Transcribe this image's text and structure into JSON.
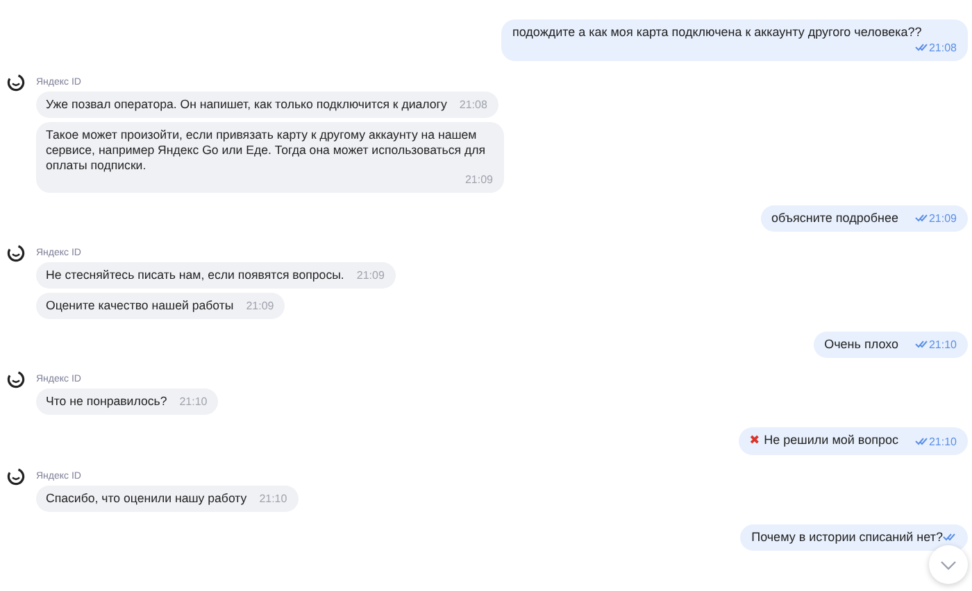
{
  "messages": [
    {
      "kind": "outgoing",
      "text": "подождите а как моя карта подключена к аккаунту другого человека??",
      "time": "21:08",
      "read": true
    },
    {
      "kind": "bot",
      "sender": "Яндекс ID",
      "bubbles": [
        {
          "text": "Уже позвал оператора. Он напишет, как только подключится к диалогу",
          "time": "21:08"
        },
        {
          "text": "Такое может произойти, если привязать карту к другому аккаунту на нашем сервисе, например Яндекс Go или Еде. Тогда она может использоваться для оплаты подписки.",
          "time": "21:09"
        }
      ]
    },
    {
      "kind": "outgoing",
      "text": "объясните подробнее",
      "time": "21:09",
      "read": true
    },
    {
      "kind": "bot",
      "sender": "Яндекс ID",
      "bubbles": [
        {
          "text": "Не стесняйтесь писать нам, если появятся вопросы.",
          "time": "21:09"
        },
        {
          "text": "Оцените качество нашей работы",
          "time": "21:09"
        }
      ]
    },
    {
      "kind": "outgoing",
      "text": "Очень плохо",
      "time": "21:10",
      "read": true
    },
    {
      "kind": "bot",
      "sender": "Яндекс ID",
      "bubbles": [
        {
          "text": "Что не понравилось?",
          "time": "21:10"
        }
      ]
    },
    {
      "kind": "outgoing",
      "emoji": "✖",
      "text": "Не решили мой вопрос",
      "time": "21:10",
      "read": true
    },
    {
      "kind": "bot",
      "sender": "Яндекс ID",
      "bubbles": [
        {
          "text": "Спасибо, что оценили нашу работу",
          "time": "21:10"
        }
      ]
    },
    {
      "kind": "outgoing",
      "text": "Почему в истории списаний нет?",
      "read": true
    }
  ],
  "scroll_down_button": {
    "visible": true
  }
}
